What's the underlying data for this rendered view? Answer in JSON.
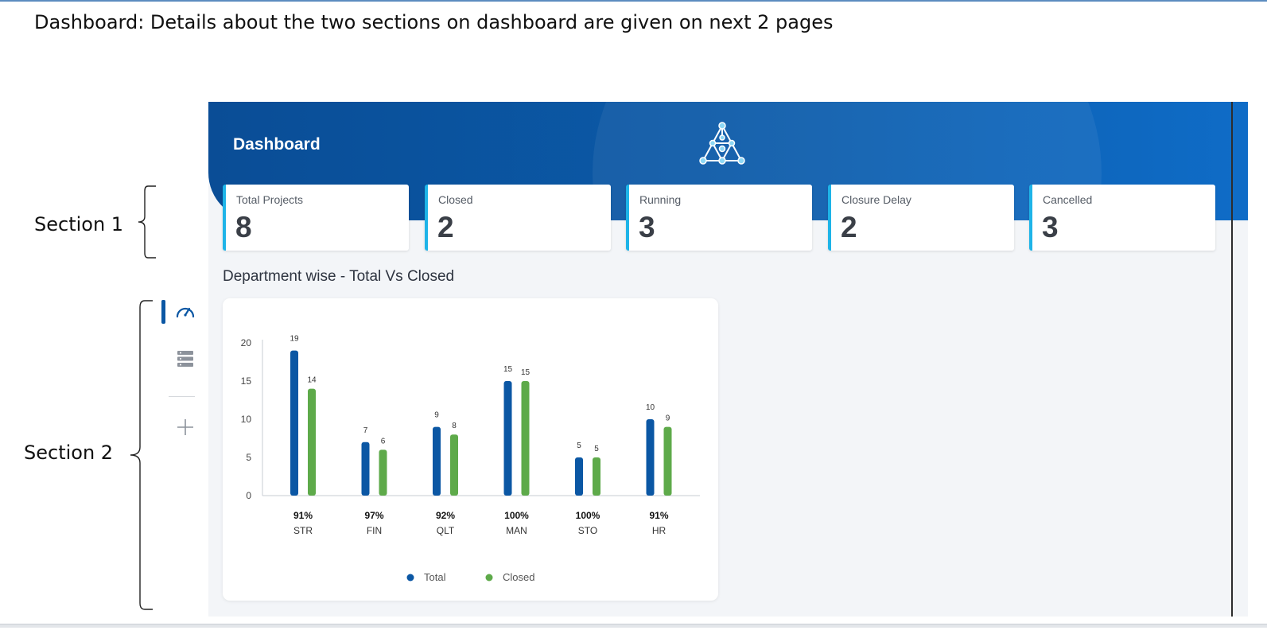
{
  "document": {
    "heading": "Dashboard: Details about the two sections on dashboard are given on next 2 pages",
    "annotations": {
      "section_1": "Section 1",
      "section_2": "Section 2"
    }
  },
  "app": {
    "header_title": "Dashboard",
    "sidebar": [
      {
        "icon": "speedometer-icon",
        "active": true
      },
      {
        "icon": "server-list-icon",
        "active": false
      },
      {
        "icon": "plus-icon",
        "active": false
      }
    ],
    "summary_cards": [
      {
        "label": "Total Projects",
        "value": "8"
      },
      {
        "label": "Closed",
        "value": "2"
      },
      {
        "label": "Running",
        "value": "3"
      },
      {
        "label": "Closure Delay",
        "value": "2"
      },
      {
        "label": "Cancelled",
        "value": "3"
      }
    ],
    "chart_section_title": "Department wise - Total Vs Closed",
    "colors": {
      "header": "#0b5aa8",
      "card_accent": "#1eb4e8",
      "total": "#0b57a4",
      "closed": "#5eaa4a"
    }
  },
  "chart_data": {
    "type": "bar",
    "title": "Department wise - Total Vs Closed",
    "categories": [
      "STR",
      "FIN",
      "QLT",
      "MAN",
      "STO",
      "HR"
    ],
    "percentages": [
      "91%",
      "97%",
      "92%",
      "100%",
      "100%",
      "91%"
    ],
    "series": [
      {
        "name": "Total",
        "color": "#0b57a4",
        "values": [
          19,
          7,
          9,
          15,
          5,
          10
        ]
      },
      {
        "name": "Closed",
        "color": "#5eaa4a",
        "values": [
          14,
          6,
          8,
          15,
          5,
          9
        ]
      }
    ],
    "yticks": [
      0,
      5,
      10,
      15,
      20
    ],
    "ylim": [
      0,
      20
    ],
    "legend_position": "bottom-center",
    "grid": false
  }
}
